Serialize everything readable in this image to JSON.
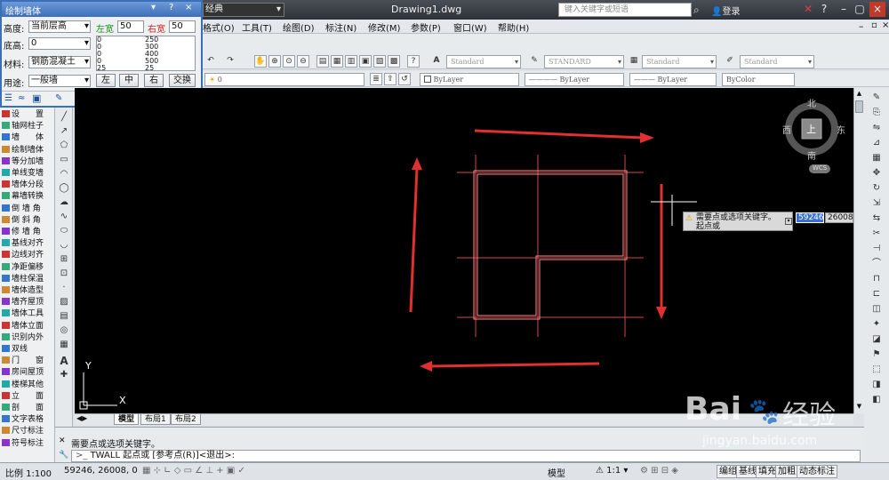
{
  "titlebar": {
    "workspace": "经典",
    "document": "Drawing1.dwg",
    "search_placeholder": "键入关键字或短语",
    "login": "登录"
  },
  "menu": [
    "格式(O)",
    "工具(T)",
    "绘图(D)",
    "标注(N)",
    "修改(M)",
    "参数(P)",
    "窗口(W)",
    "帮助(H)"
  ],
  "palette": {
    "title": "绘制墙体",
    "height_label": "高度:",
    "height_value": "当前层高",
    "left_width_label": "左宽",
    "left_width_value": "50",
    "right_width_label": "右宽",
    "right_width_value": "50",
    "base_label": "底高:",
    "base_value": "0",
    "material_label": "材料:",
    "material_value": "钢筋混凝土",
    "usage_label": "用途:",
    "usage_value": "一般墙",
    "width_list": [
      [
        "0",
        "250"
      ],
      [
        "0",
        "300"
      ],
      [
        "0",
        "400"
      ],
      [
        "0",
        "500"
      ],
      [
        "25",
        "25"
      ]
    ],
    "btn_left": "左",
    "btn_center": "中",
    "btn_right": "右",
    "btn_swap": "交换",
    "m_label": "M",
    "accent": "#3d6eb8"
  },
  "leftpanel": {
    "items": [
      "设　　置",
      "轴网柱子",
      "墙　　体",
      "绘制墙体",
      "等分加墙",
      "单线变墙",
      "墙体分段",
      "幕墙转换",
      "倒 墙 角",
      "倒 斜 角",
      "修 墙 角",
      "基线对齐",
      "边线对齐",
      "净距偏移",
      "墙柱保温",
      "墙体造型",
      "墙齐屋顶",
      "墙体工具",
      "墙体立面",
      "识别内外",
      "双线",
      "门　　窗",
      "房间屋顶",
      "楼梯其他",
      "立　　面",
      "剖　　面",
      "文字表格",
      "尺寸标注",
      "符号标注"
    ]
  },
  "toolbar": {
    "text_style": "Standard",
    "dim_style": "STANDARD",
    "table_style": "Standard",
    "mleader_style": "Standard",
    "layer": "0",
    "color": "ByLayer",
    "linetype": "ByLayer",
    "lineweight": "ByLayer",
    "plotstyle": "ByColor"
  },
  "viewcube": {
    "north": "北",
    "south": "南",
    "east": "东",
    "west": "西",
    "top": "上",
    "wcs": "WCS"
  },
  "dynamic_input": {
    "prompt_line1": "需要点或选项关键字。",
    "prompt_line2": "起点或",
    "x_value": "59246",
    "y_value": "26008"
  },
  "tabs": [
    "模型",
    "布局1",
    "布局2"
  ],
  "command": {
    "history": "需要点或选项关键字。",
    "prompt": "TWALL 起点或 [参考点(R)]<退出>:"
  },
  "status": {
    "scale": "比例 1:100",
    "coords": "59246, 26008, 0",
    "model": "模型",
    "anno_scale": "1:1",
    "buttons": [
      "编组",
      "基线",
      "填充",
      "加粗",
      "动态标注"
    ]
  },
  "watermark": {
    "brand": "Bai",
    "brand_cn": "经验",
    "url": "jingyan.baidu.com"
  },
  "colors": {
    "canvas": "#000000",
    "wall": "#ff6a6a",
    "axis": "#d24a4a",
    "arrow": "#e03030",
    "crosshair": "#ffffff"
  }
}
